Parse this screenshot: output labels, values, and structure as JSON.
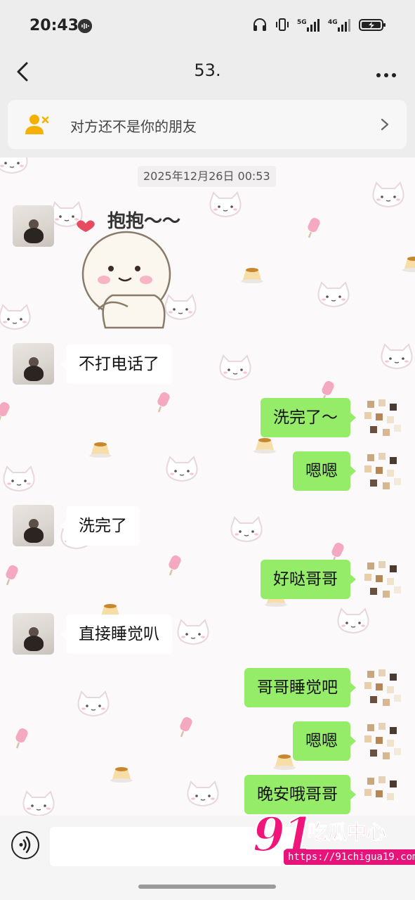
{
  "status_bar": {
    "time": "20:43",
    "network_1": "5G",
    "network_2": "4G"
  },
  "nav": {
    "title": "53."
  },
  "friend_banner": {
    "text": "对方还不是你的朋友"
  },
  "chat": {
    "timestamp": "2025年12月26日 00:53",
    "sticker_caption": "抱抱～～",
    "messages": [
      {
        "side": "left",
        "text": "不打电话了"
      },
      {
        "side": "right",
        "text": "洗完了～"
      },
      {
        "side": "right",
        "text": "嗯嗯"
      },
      {
        "side": "left",
        "text": "洗完了"
      },
      {
        "side": "right",
        "text": "好哒哥哥"
      },
      {
        "side": "left",
        "text": "直接睡觉叭"
      },
      {
        "side": "right",
        "text": "哥哥睡觉吧"
      },
      {
        "side": "right",
        "text": "嗯嗯"
      },
      {
        "side": "right",
        "text": "晚安哦哥哥"
      }
    ]
  },
  "watermark": {
    "number": "91",
    "brand": "吃瓜中心",
    "url": "https://91chigua19.com"
  },
  "colors": {
    "bubble_right": "#95ec69",
    "bubble_left": "#ffffff",
    "watermark": "#f0157a"
  }
}
